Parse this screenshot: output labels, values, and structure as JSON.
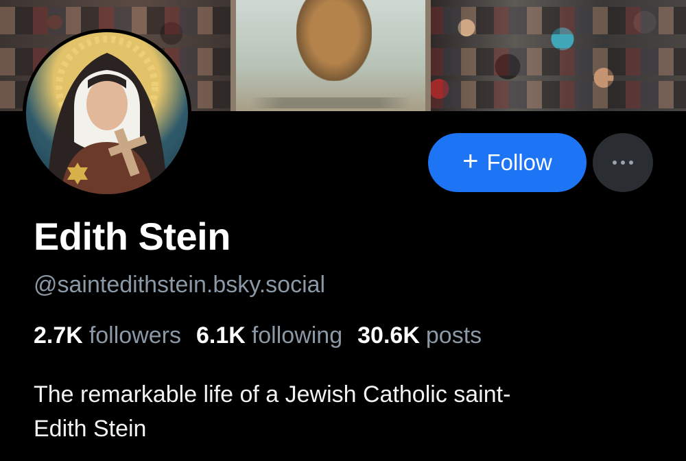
{
  "profile": {
    "display_name": "Edith Stein",
    "handle": "@saintedithstein.bsky.social",
    "bio_line1": "The remarkable life of a Jewish Catholic saint-",
    "bio_line2": "Edith Stein"
  },
  "stats": {
    "followers_count": "2.7K",
    "followers_label": "followers",
    "following_count": "6.1K",
    "following_label": "following",
    "posts_count": "30.6K",
    "posts_label": "posts"
  },
  "actions": {
    "follow_icon": "+",
    "follow_label": "Follow",
    "more_icon": "ellipsis-icon"
  },
  "colors": {
    "background": "#000000",
    "accent": "#1d74f5",
    "secondary_text": "#8b98a5",
    "more_button_bg": "#2a2e33"
  }
}
